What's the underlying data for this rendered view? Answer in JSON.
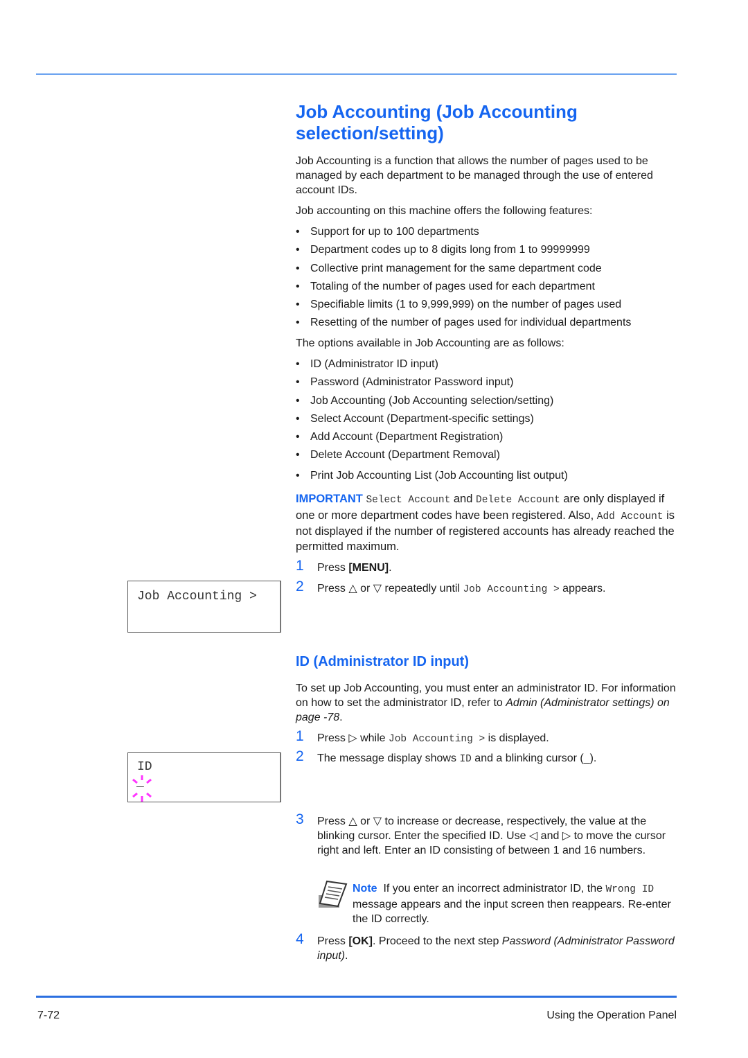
{
  "page": {
    "title": "Job Accounting (Job Accounting selection/setting)",
    "intro": "Job Accounting is a function that allows the number of pages used to be managed by each department to be managed through the use of entered account IDs.",
    "features_intro": "Job accounting on this machine offers the following features:",
    "features": [
      "Support for up to 100 departments",
      "Department codes up to 8 digits long from 1 to 99999999",
      "Collective print management for the same department code",
      "Totaling of the number of pages used for each department",
      "Specifiable limits (1 to 9,999,999) on the number of pages used",
      "Resetting of the number of pages used for individual departments"
    ],
    "options_intro": "The options available in Job Accounting are as follows:",
    "options": [
      "ID (Administrator ID input)",
      "Password (Administrator Password input)",
      "Job Accounting (Job Accounting selection/setting)",
      "Select Account (Department-specific settings)",
      "Add Account (Department Registration)",
      "Delete Account (Department Removal)",
      "Print Job Accounting List (Job Accounting list output)"
    ],
    "important": {
      "label": "IMPORTANT",
      "code1": "Select Account",
      "and": "and",
      "code2": "Delete Account",
      "text1": "are only displayed if one or more department codes have been registered. Also,",
      "code3": "Add Account",
      "text2": "is not displayed if the number of registered accounts has already reached the permitted maximum."
    },
    "steps_a": [
      {
        "num": "1",
        "pre": "Press ",
        "bold": "[MENU]",
        "post": "."
      },
      {
        "num": "2",
        "pre": "Press △ or ▽ repeatedly until ",
        "code": "Job Accounting >",
        "post": " appears."
      }
    ],
    "lcd1": {
      "line1": "Job Accounting >"
    },
    "section2": {
      "title": "ID (Administrator ID input)",
      "intro_pre": "To set up Job Accounting, you must enter an administrator ID. For information on how to set the administrator ID, refer to ",
      "intro_link": "Admin (Administrator settings) on page -78",
      "intro_post": "."
    },
    "steps_b": [
      {
        "num": "1",
        "pre": "Press ▷ while ",
        "code": "Job Accounting >",
        "post": " is displayed."
      },
      {
        "num": "2",
        "pre": "The message display shows ",
        "code": "ID",
        "post": " and a blinking cursor (_)."
      },
      {
        "num": "3",
        "text": "Press △ or ▽ to increase or decrease, respectively, the value at the blinking cursor.  Enter the specified ID. Use ◁ and ▷ to move the cursor right and left. Enter an ID consisting of between 1 and 16 numbers."
      },
      {
        "num": "4",
        "pre": "Press ",
        "bold": "[OK]",
        "mid": ". Proceed to the next step ",
        "ital": "Password (Administrator Password input)",
        "post": "."
      }
    ],
    "lcd2": {
      "line1": "ID",
      "cursor": "_"
    },
    "note": {
      "label": "Note",
      "pre": "If you enter an incorrect administrator ID, the ",
      "code": "Wrong ID",
      "post": " message appears and the input screen then reappears. Re-enter the ID correctly."
    },
    "footer": {
      "page_number": "7-72",
      "section": "Using the Operation Panel"
    },
    "colors": {
      "accent": "#1565f0",
      "cursor_blink": "#ff33ff"
    }
  }
}
